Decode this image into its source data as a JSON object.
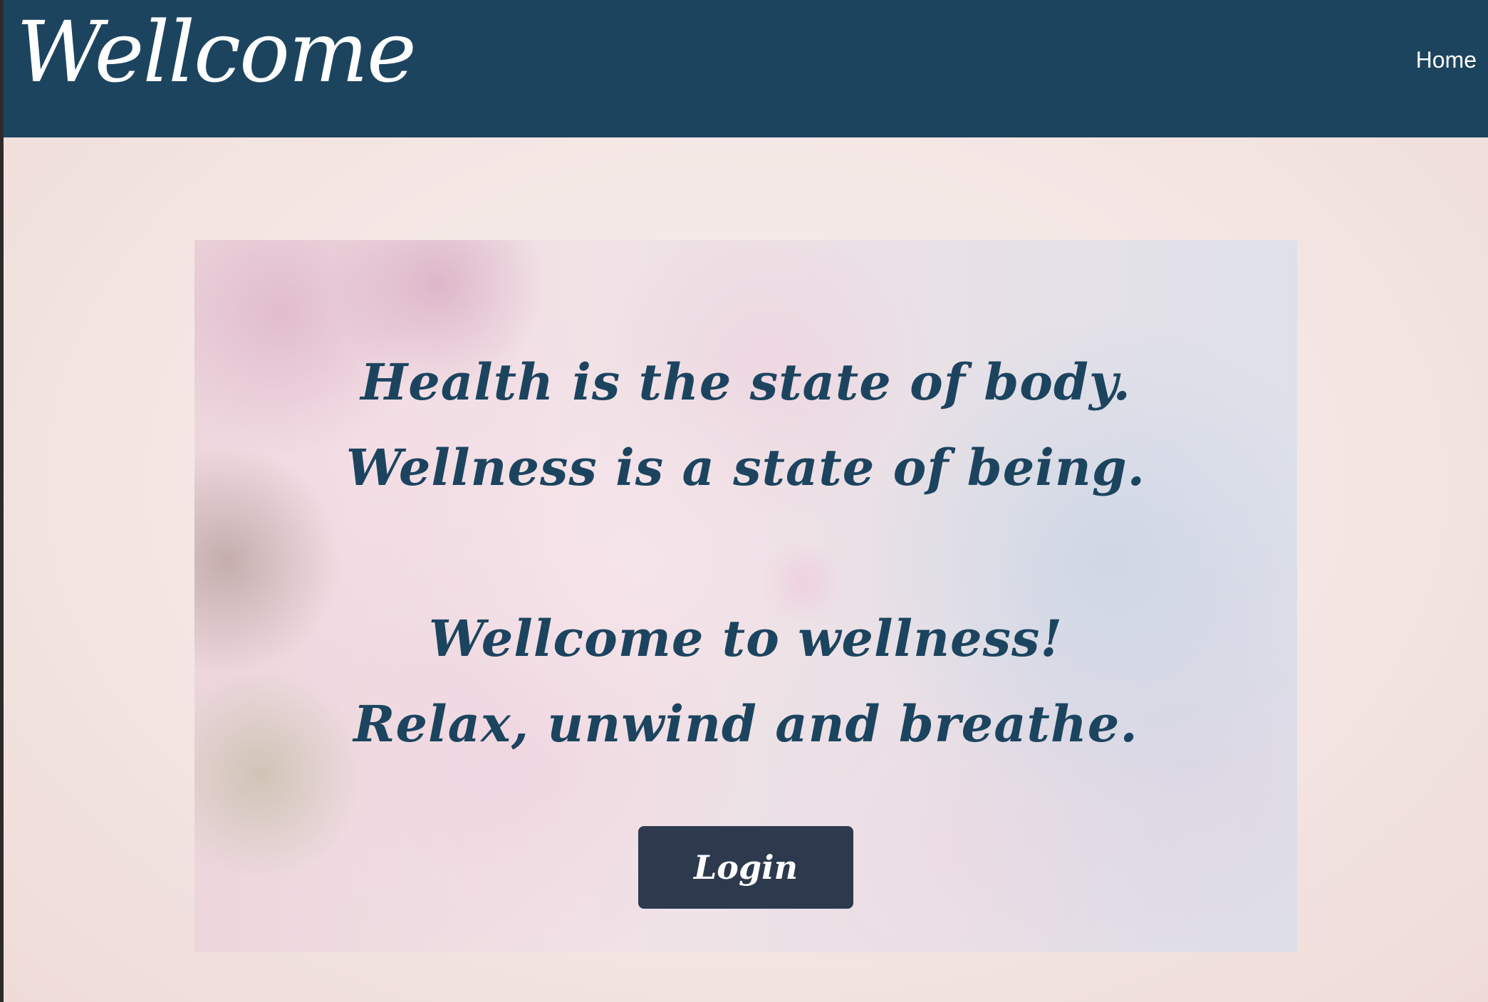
{
  "navbar": {
    "brand": "Wellcome",
    "links": [
      {
        "label": "Home"
      }
    ]
  },
  "hero": {
    "lines_group_1": [
      "Health is the state of body.",
      "Wellness is a state of being."
    ],
    "lines_group_2": [
      "Wellcome to wellness!",
      "Relax, unwind and breathe."
    ],
    "login_label": "Login"
  },
  "colors": {
    "navbar_bg": "#1c445f",
    "page_bg": "#f4e6e3",
    "text_accent": "#1c445f",
    "button_bg": "#2d3a4e",
    "button_text": "#ffffff"
  }
}
